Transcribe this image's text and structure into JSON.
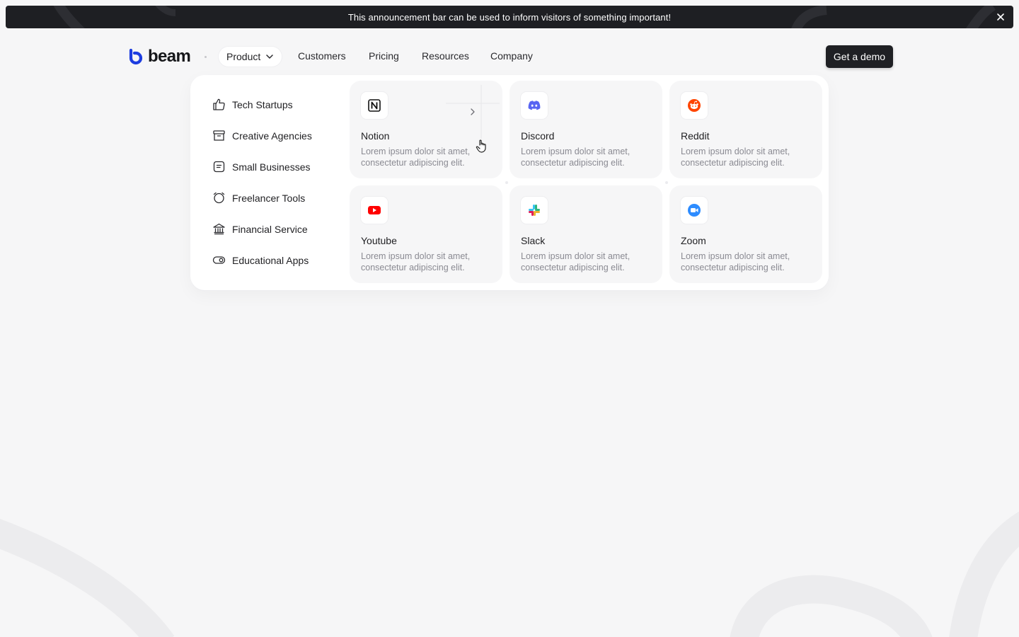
{
  "announcement": {
    "text": "This announcement bar can be used to inform visitors of something important!"
  },
  "brand": {
    "name": "beam",
    "accent": "#1d3de0"
  },
  "nav": {
    "product_label": "Product",
    "links": [
      "Customers",
      "Pricing",
      "Resources",
      "Company"
    ],
    "cta_label": "Get a demo"
  },
  "menu": {
    "categories": [
      {
        "label": "Tech Startups",
        "icon": "thumbs-up-icon"
      },
      {
        "label": "Creative Agencies",
        "icon": "archive-icon"
      },
      {
        "label": "Small Businesses",
        "icon": "document-icon"
      },
      {
        "label": "Freelancer Tools",
        "icon": "alarm-clock-icon"
      },
      {
        "label": "Financial Service",
        "icon": "bank-icon"
      },
      {
        "label": "Educational Apps",
        "icon": "toggle-icon"
      }
    ],
    "apps": [
      {
        "name": "Notion",
        "description": "Lorem ipsum dolor sit amet, consectetur adipiscing elit.",
        "icon": "notion-icon"
      },
      {
        "name": "Discord",
        "description": "Lorem ipsum dolor sit amet, consectetur adipiscing elit.",
        "icon": "discord-icon",
        "color": "#5865f2"
      },
      {
        "name": "Reddit",
        "description": "Lorem ipsum dolor sit amet, consectetur adipiscing elit.",
        "icon": "reddit-icon",
        "color": "#ff4500"
      },
      {
        "name": "Youtube",
        "description": "Lorem ipsum dolor sit amet, consectetur adipiscing elit.",
        "icon": "youtube-icon",
        "color": "#ff0000"
      },
      {
        "name": "Slack",
        "description": "Lorem ipsum dolor sit amet, consectetur adipiscing elit.",
        "icon": "slack-icon"
      },
      {
        "name": "Zoom",
        "description": "Lorem ipsum dolor sit amet, consectetur adipiscing elit.",
        "icon": "zoom-icon",
        "color": "#2d8cff"
      }
    ]
  }
}
